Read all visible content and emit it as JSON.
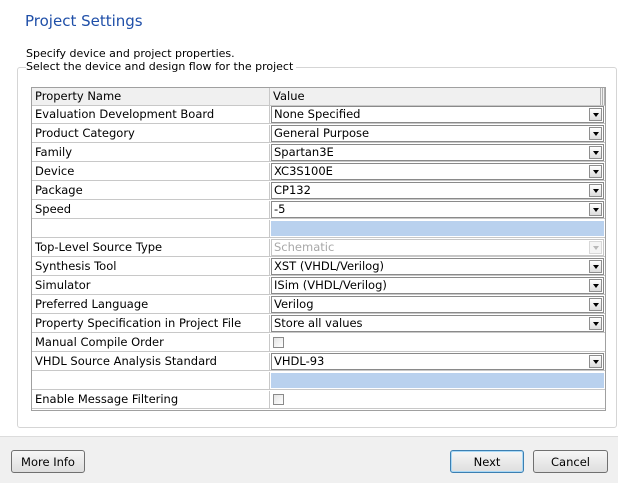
{
  "header": {
    "title": "Project Settings",
    "description": "Specify device and project properties."
  },
  "group": {
    "caption": "Select the device and design flow for the project"
  },
  "grid": {
    "columns": [
      "Property Name",
      "Value"
    ],
    "rows": {
      "eval_board": {
        "name": "Evaluation Development Board",
        "value": "None Specified"
      },
      "product_category": {
        "name": "Product Category",
        "value": "General Purpose"
      },
      "family": {
        "name": "Family",
        "value": "Spartan3E"
      },
      "device": {
        "name": "Device",
        "value": "XC3S100E"
      },
      "package": {
        "name": "Package",
        "value": "CP132"
      },
      "speed": {
        "name": "Speed",
        "value": "-5"
      },
      "top_level": {
        "name": "Top-Level Source Type",
        "value": "Schematic"
      },
      "synthesis": {
        "name": "Synthesis Tool",
        "value": "XST (VHDL/Verilog)"
      },
      "simulator": {
        "name": "Simulator",
        "value": "ISim (VHDL/Verilog)"
      },
      "language": {
        "name": "Preferred Language",
        "value": "Verilog"
      },
      "prop_spec": {
        "name": "Property Specification in Project File",
        "value": "Store all values"
      },
      "manual_compile": {
        "name": "Manual Compile Order",
        "checked": false
      },
      "vhdl_standard": {
        "name": "VHDL Source Analysis Standard",
        "value": "VHDL-93"
      },
      "msg_filter": {
        "name": "Enable Message Filtering",
        "checked": false
      }
    }
  },
  "footer": {
    "more_info": "More Info",
    "next": "Next",
    "cancel": "Cancel"
  }
}
